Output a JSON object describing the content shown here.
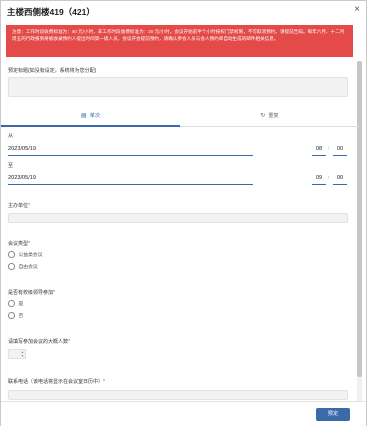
{
  "dialog": {
    "title": "主楼西侧楼419（421）",
    "close_glyph": "×"
  },
  "warning": {
    "text": "注意：工作时段收费标准为：40 元/小时，非工作时段收费标准为：20 元/小时。会议开始前半个小时按权门禁权限，不可取消预约。请提前告知。每年六月、十二月周五的行政报到将被收录预约人提出时间第一级人员，会议开会提前预约，请确认参会人员与会人预约单自动生成的邮件相关信息。"
  },
  "form": {
    "reservation_title_label": "预定标题(如没有设定，系统将为您分配)",
    "tabs": [
      {
        "label": "单次",
        "icon": "calendar-icon"
      },
      {
        "label": "重复",
        "icon": "repeat-icon"
      }
    ],
    "from_label": "从",
    "start_date": "2023/05/19",
    "start_hour": "08",
    "start_minute": "00",
    "to_label": "至",
    "end_date": "2023/05/19",
    "end_hour": "09",
    "end_minute": "00",
    "time_colon": ":",
    "host_unit_label": "主办单位",
    "meeting_type_label": "会议类型",
    "meeting_type_options": [
      "公益类会议",
      "自由会议"
    ],
    "leaders_label": "是否有校级领导参加",
    "leaders_options": [
      "是",
      "否"
    ],
    "attendees_label": "请填写参加会议的大概人数",
    "phone_label": "联系电话（该电话将显示在会议室日历中）",
    "required_mark": "*"
  },
  "footer": {
    "confirm_label": "预定"
  },
  "colors": {
    "warning_bg": "#e34a48",
    "accent": "#3b6aa8",
    "required": "#d9302c"
  }
}
